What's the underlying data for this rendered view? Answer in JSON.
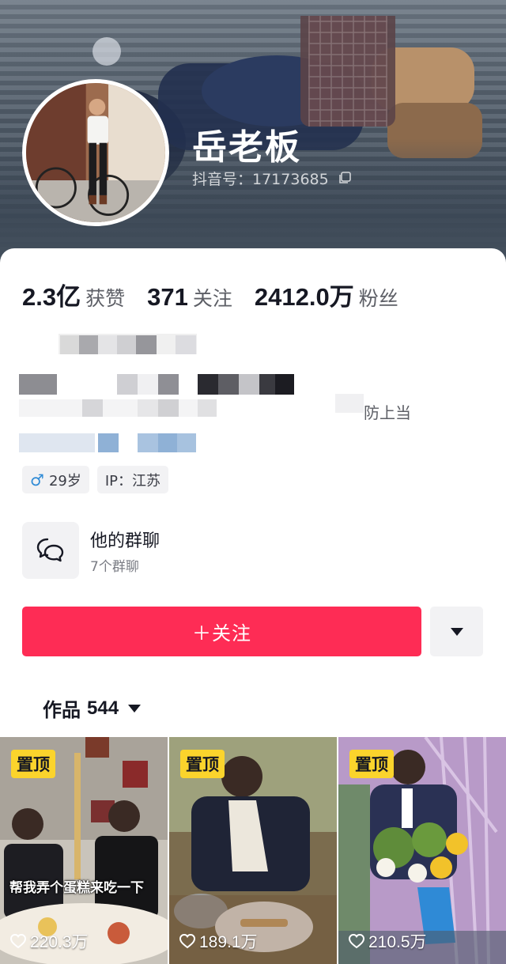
{
  "profile": {
    "nickname": "岳老板",
    "douyin_id": "抖音号：17173685",
    "age_tag": "29岁",
    "ip_tag": "IP：江苏",
    "bio_visible_fragment": "防上当"
  },
  "stats": [
    {
      "num": "2.3亿",
      "label": "获赞"
    },
    {
      "num": "371",
      "label": "关注"
    },
    {
      "num": "2412.0万",
      "label": "粉丝"
    }
  ],
  "group_chat": {
    "title": "他的群聊",
    "subtitle": "7个群聊"
  },
  "actions": {
    "follow_label": "＋关注"
  },
  "works": {
    "label": "作品",
    "count": "544"
  },
  "videos": [
    {
      "pinned_label": "置顶",
      "likes": "220.3万",
      "caption": "帮我弄个蛋糕来吃一下"
    },
    {
      "pinned_label": "置顶",
      "likes": "189.1万",
      "caption": ""
    },
    {
      "pinned_label": "置顶",
      "likes": "210.5万",
      "caption": ""
    }
  ],
  "colors": {
    "accent": "#fe2c55",
    "pin_badge": "#fbd42c",
    "male_icon": "#2f8bd6"
  }
}
